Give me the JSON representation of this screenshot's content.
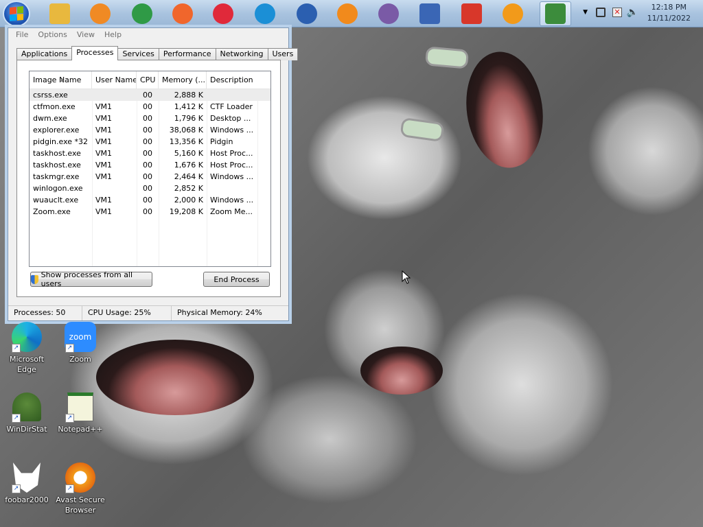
{
  "taskbar": {
    "apps": [
      {
        "name": "File Explorer",
        "icon": "folder-icon",
        "color": "#e8b83e"
      },
      {
        "name": "Media Player",
        "icon": "media-player-icon",
        "color": "#f08a24"
      },
      {
        "name": "Chrome",
        "icon": "chrome-icon",
        "color": "#2f9a46"
      },
      {
        "name": "Firefox",
        "icon": "firefox-icon",
        "color": "#f0662c"
      },
      {
        "name": "Opera",
        "icon": "opera-icon",
        "color": "#e0293a"
      },
      {
        "name": "Edge",
        "icon": "edge-icon",
        "color": "#1b8fd6"
      },
      {
        "name": "Thunderbird",
        "icon": "thunderbird-icon",
        "color": "#2b5fb0"
      },
      {
        "name": "VLC",
        "icon": "vlc-icon",
        "color": "#f18a1c"
      },
      {
        "name": "Pidgin",
        "icon": "pidgin-icon",
        "color": "#7a5aa6"
      },
      {
        "name": "Paint",
        "icon": "paint-icon",
        "color": "#3a66b5"
      },
      {
        "name": "Text Editor",
        "icon": "document-icon",
        "color": "#d8372a"
      },
      {
        "name": "Avast Secure Browser",
        "icon": "avast-icon",
        "color": "#f29a1a"
      },
      {
        "name": "Task Manager",
        "icon": "task-manager-icon",
        "color": "#3c8c3c"
      }
    ],
    "clock": {
      "time": "12:18 PM",
      "date": "11/11/2022"
    }
  },
  "window": {
    "menu": [
      "File",
      "Options",
      "View",
      "Help"
    ],
    "tabs": [
      "Applications",
      "Processes",
      "Services",
      "Performance",
      "Networking",
      "Users"
    ],
    "selected_tab": "Processes",
    "columns": [
      "Image Name",
      "User Name",
      "CPU",
      "Memory (...",
      "Description"
    ],
    "rows": [
      {
        "image": "csrss.exe",
        "user": "",
        "cpu": "00",
        "mem": "2,888 K",
        "desc": ""
      },
      {
        "image": "ctfmon.exe",
        "user": "VM1",
        "cpu": "00",
        "mem": "1,412 K",
        "desc": "CTF Loader"
      },
      {
        "image": "dwm.exe",
        "user": "VM1",
        "cpu": "00",
        "mem": "1,796 K",
        "desc": "Desktop ..."
      },
      {
        "image": "explorer.exe",
        "user": "VM1",
        "cpu": "00",
        "mem": "38,068 K",
        "desc": "Windows ..."
      },
      {
        "image": "pidgin.exe *32",
        "user": "VM1",
        "cpu": "00",
        "mem": "13,356 K",
        "desc": "Pidgin"
      },
      {
        "image": "taskhost.exe",
        "user": "VM1",
        "cpu": "00",
        "mem": "5,160 K",
        "desc": "Host Proc..."
      },
      {
        "image": "taskhost.exe",
        "user": "VM1",
        "cpu": "00",
        "mem": "1,676 K",
        "desc": "Host Proc..."
      },
      {
        "image": "taskmgr.exe",
        "user": "VM1",
        "cpu": "00",
        "mem": "2,464 K",
        "desc": "Windows ..."
      },
      {
        "image": "winlogon.exe",
        "user": "",
        "cpu": "00",
        "mem": "2,852 K",
        "desc": ""
      },
      {
        "image": "wuauclt.exe",
        "user": "VM1",
        "cpu": "00",
        "mem": "2,000 K",
        "desc": "Windows ..."
      },
      {
        "image": "Zoom.exe",
        "user": "VM1",
        "cpu": "00",
        "mem": "19,208 K",
        "desc": "Zoom Me..."
      }
    ],
    "show_all_label": "Show processes from all users",
    "end_process_label": "End Process",
    "status": {
      "processes": "Processes: 50",
      "cpu": "CPU Usage: 25%",
      "memory": "Physical Memory: 24%"
    }
  },
  "desktop": {
    "icons": [
      {
        "label": "Microsoft Edge",
        "icon": "edge-icon"
      },
      {
        "label": "Zoom",
        "icon": "zoom-icon"
      },
      {
        "label": "WinDirStat",
        "icon": "windirstat-icon"
      },
      {
        "label": "Notepad++",
        "icon": "notepad-plus-plus-icon"
      },
      {
        "label": "foobar2000",
        "icon": "foobar2000-icon"
      },
      {
        "label": "Avast Secure Browser",
        "icon": "avast-icon"
      }
    ]
  }
}
